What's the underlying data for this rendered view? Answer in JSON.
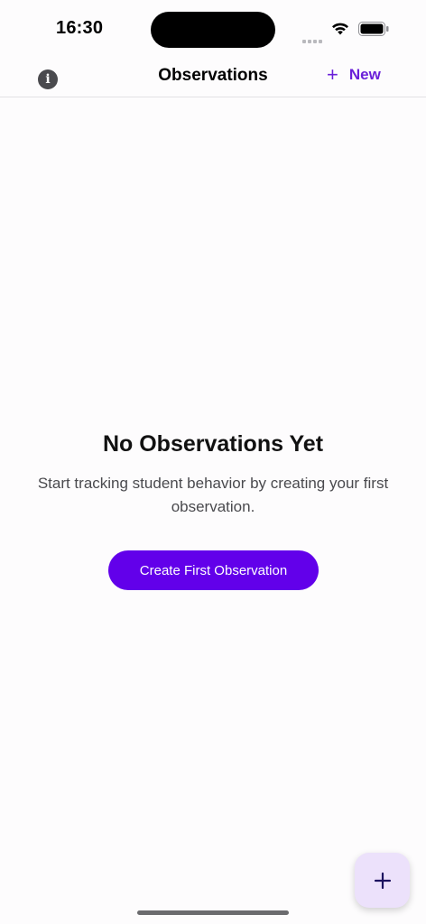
{
  "status_bar": {
    "time": "16:30",
    "icons": [
      "signal-icon",
      "wifi-icon",
      "battery-icon"
    ]
  },
  "nav": {
    "info_icon": "info-icon",
    "info_glyph": "i",
    "title": "Observations",
    "new_icon": "plus-icon",
    "new_glyph": "+",
    "new_label": "New"
  },
  "empty_state": {
    "title": "No Observations Yet",
    "description": "Start tracking student behavior by creating your first observation.",
    "cta_label": "Create First Observation"
  },
  "fab": {
    "icon": "plus-icon"
  },
  "colors": {
    "accent": "#6200ea",
    "accent_text": "#6a1fd9",
    "fab_background": "#ece1fb",
    "background": "#fdfcfd"
  }
}
